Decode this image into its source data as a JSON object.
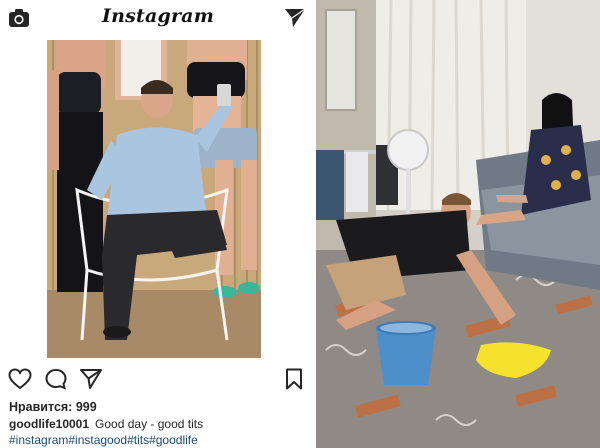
{
  "app": {
    "title": "Instagram"
  },
  "header": {
    "camera_icon": "camera-icon",
    "direct_icon": "paper-plane-icon"
  },
  "post": {
    "actions": {
      "like_icon": "heart-icon",
      "comment_icon": "comment-bubble-icon",
      "share_icon": "paper-plane-icon",
      "save_icon": "bookmark-icon"
    },
    "likes_text": "Нравится: 999",
    "username": "goodlife10001",
    "caption_text": "Good day - good tits",
    "hashtags": "#instagram#instagood#tits#goodlife"
  },
  "colors": {
    "hashtag": "#1b4b7a",
    "text": "#262626",
    "background": "#ffffff"
  }
}
